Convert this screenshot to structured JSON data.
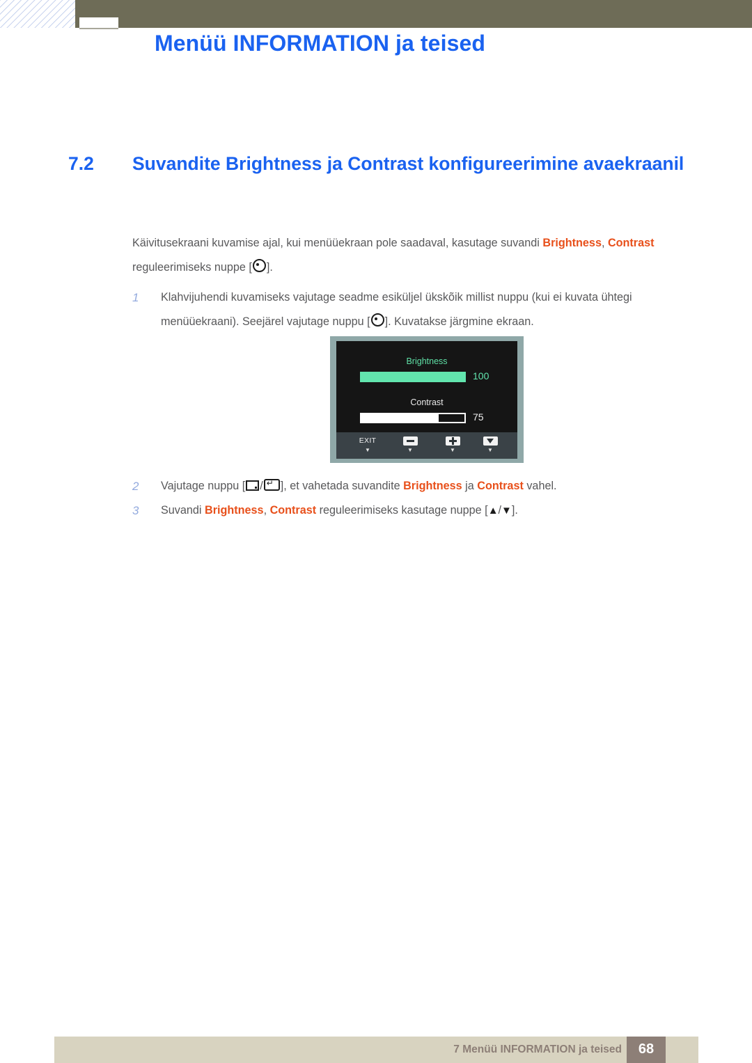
{
  "header": {
    "title": "Menüü INFORMATION ja teised"
  },
  "section": {
    "number": "7.2",
    "title": "Suvandite Brightness ja Contrast konfigureerimine avaekraanil"
  },
  "intro": {
    "part1": "Käivitusekraani kuvamise ajal, kui menüüekraan pole saadaval, kasutage suvandi ",
    "hl1": "Brightness",
    "sep1": ", ",
    "hl2": "Contrast",
    "part2": " reguleerimiseks nuppe [",
    "part3": "]."
  },
  "steps": [
    {
      "number": "1",
      "text_a": "Klahvijuhendi kuvamiseks vajutage seadme esiküljel ükskõik millist nuppu (kui ei kuvata ühtegi menüüekraani). Seejärel vajutage nuppu [",
      "text_b": "]. Kuvatakse järgmine ekraan."
    },
    {
      "number": "2",
      "text_a": "Vajutage nuppu [",
      "sep": "/",
      "text_b": "], et vahetada suvandite ",
      "hl1": "Brightness",
      "text_c": " ja ",
      "hl2": "Contrast",
      "text_d": " vahel."
    },
    {
      "number": "3",
      "text_a": "Suvandi ",
      "hl1": "Brightness",
      "sep1": ", ",
      "hl2": "Contrast",
      "text_b": " reguleerimiseks kasutage nuppe [",
      "up": "▲",
      "slash": "/",
      "down": "▼",
      "text_c": "]."
    }
  ],
  "osd": {
    "brightness_label": "Brightness",
    "brightness_value": "100",
    "brightness_percent": "100%",
    "contrast_label": "Contrast",
    "contrast_value": "75",
    "contrast_percent": "75%",
    "buttons": [
      {
        "label": "EXIT",
        "caret": "▼",
        "glyph": "text"
      },
      {
        "label": "",
        "caret": "▼",
        "glyph": "minus"
      },
      {
        "label": "",
        "caret": "▼",
        "glyph": "plus"
      },
      {
        "label": "",
        "caret": "▼",
        "glyph": "down"
      }
    ]
  },
  "footer": {
    "text": "7 Menüü INFORMATION ja teised",
    "page": "68"
  },
  "colors": {
    "accent_blue": "#1a62f0",
    "highlight_orange": "#e8501b",
    "step_number_blue": "#93aade",
    "olive": "#6e6c57",
    "footer_beige": "#d8d3c0",
    "footer_brown": "#8d7f77",
    "osd_green": "#62e5ae",
    "osd_bezel": "#8fa8a8"
  }
}
